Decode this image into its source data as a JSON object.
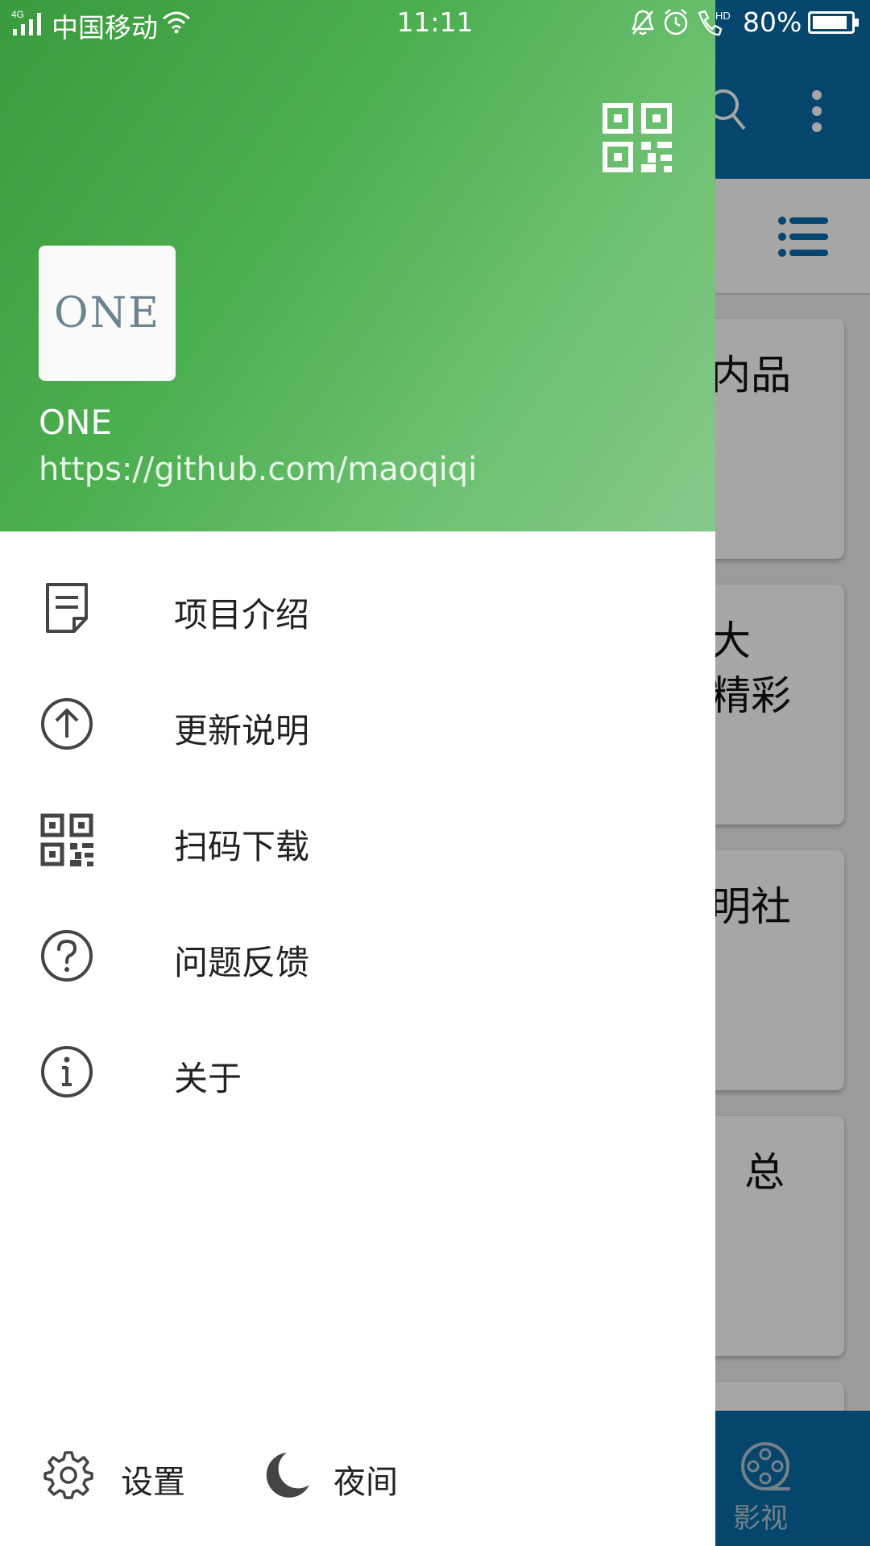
{
  "status_bar": {
    "network": "4G",
    "carrier": "中国移动",
    "time": "11:11",
    "hd_label": "HD",
    "battery": "80%"
  },
  "header": {
    "logo_text": "ONE",
    "app_name": "ONE",
    "url": "https://github.com/maoqiqi",
    "qr_icon": "qr-code-icon"
  },
  "menu": [
    {
      "label": "项目介绍",
      "icon": "document-icon"
    },
    {
      "label": "更新说明",
      "icon": "arrow-up-circle-icon"
    },
    {
      "label": "扫码下载",
      "icon": "qr-code-icon"
    },
    {
      "label": "问题反馈",
      "icon": "help-circle-icon"
    },
    {
      "label": "关于",
      "icon": "info-circle-icon"
    }
  ],
  "footer": {
    "settings_label": "设置",
    "night_label": "夜间"
  },
  "background": {
    "cards": [
      "内品",
      "大\n精彩",
      "明社",
      "总"
    ],
    "bottom_tab_label": "影视"
  },
  "colors": {
    "header_gradient_start": "#3a9a3d",
    "header_gradient_end": "#86c98a",
    "app_bar": "#0a6aa6"
  }
}
